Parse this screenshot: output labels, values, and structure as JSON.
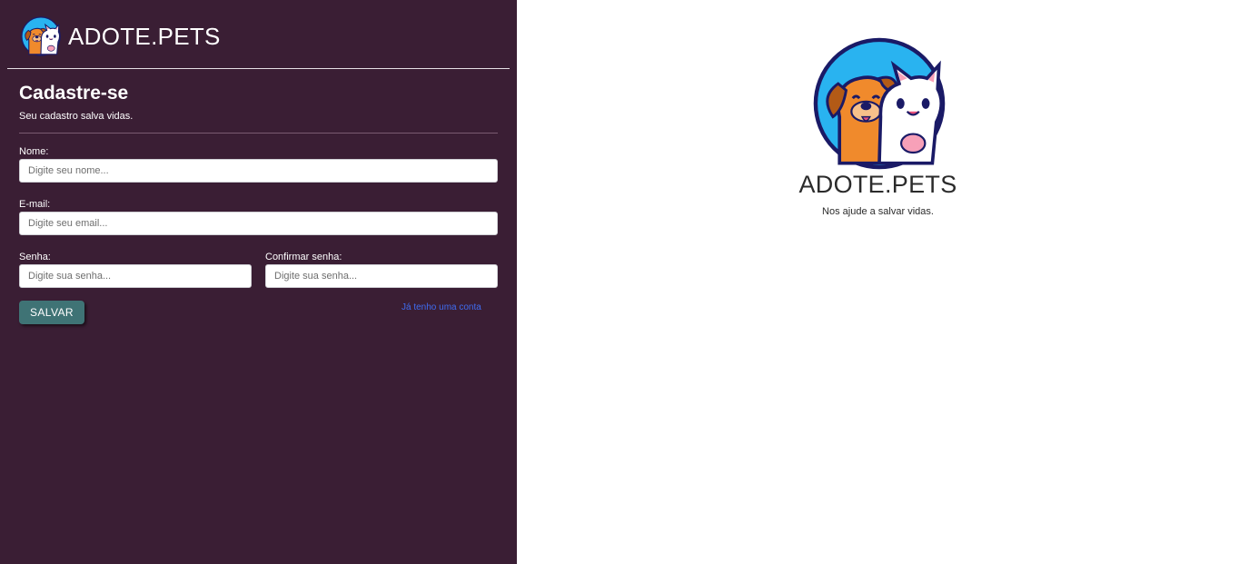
{
  "brand": {
    "name": "ADOTE.PETS",
    "logo_icon": "dog-and-cat-logo-icon"
  },
  "form": {
    "title": "Cadastre-se",
    "subtitle": "Seu cadastro salva vidas.",
    "fields": {
      "name": {
        "label": "Nome:",
        "placeholder": "Digite seu nome...",
        "value": ""
      },
      "email": {
        "label": "E-mail:",
        "placeholder": "Digite seu email...",
        "value": ""
      },
      "password": {
        "label": "Senha:",
        "placeholder": "Digite sua senha...",
        "value": ""
      },
      "confirm_password": {
        "label": "Confirmar senha:",
        "placeholder": "Digite sua senha...",
        "value": ""
      }
    },
    "save_label": "SALVAR",
    "login_link": "Já tenho uma conta"
  },
  "hero": {
    "title": "ADOTE.PETS",
    "subtitle": "Nos ajude a salvar vidas.",
    "logo_icon": "dog-and-cat-logo-icon"
  },
  "colors": {
    "sidebar_bg": "#3a1e34",
    "button_bg": "#3f7375",
    "link": "#3f6cf0",
    "logo_circle": "#29b3f0",
    "dog": "#f08a2c",
    "cat": "#ffffff",
    "outline": "#1a1a66"
  }
}
